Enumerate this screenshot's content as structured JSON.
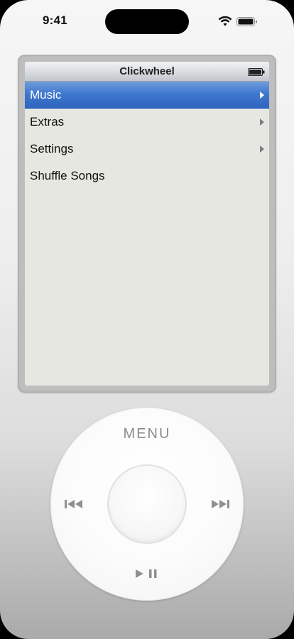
{
  "status_bar": {
    "time": "9:41",
    "icons": [
      "wifi-icon",
      "battery-icon"
    ]
  },
  "screen": {
    "title": "Clickwheel",
    "battery_icon": "battery-icon",
    "menu_items": [
      {
        "label": "Music",
        "selected": true,
        "has_submenu": true
      },
      {
        "label": "Extras",
        "selected": false,
        "has_submenu": true
      },
      {
        "label": "Settings",
        "selected": false,
        "has_submenu": true
      },
      {
        "label": "Shuffle Songs",
        "selected": false,
        "has_submenu": false
      }
    ]
  },
  "wheel": {
    "menu_label": "MENU",
    "prev_icon": "previous-track-icon",
    "next_icon": "next-track-icon",
    "play_pause_icon": "play-pause-icon"
  },
  "colors": {
    "selection": "#3f78cf",
    "screen_bg": "#e7e7e1",
    "wheel_label": "#8c8c8c"
  }
}
